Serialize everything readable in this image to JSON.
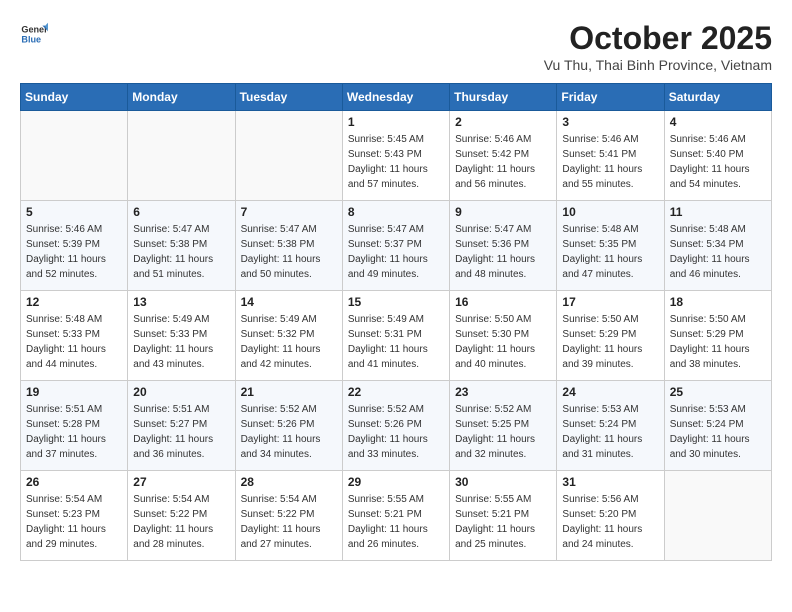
{
  "logo": {
    "line1": "General",
    "line2": "Blue"
  },
  "title": "October 2025",
  "subtitle": "Vu Thu, Thai Binh Province, Vietnam",
  "weekdays": [
    "Sunday",
    "Monday",
    "Tuesday",
    "Wednesday",
    "Thursday",
    "Friday",
    "Saturday"
  ],
  "weeks": [
    [
      {
        "day": "",
        "info": ""
      },
      {
        "day": "",
        "info": ""
      },
      {
        "day": "",
        "info": ""
      },
      {
        "day": "1",
        "info": "Sunrise: 5:45 AM\nSunset: 5:43 PM\nDaylight: 11 hours\nand 57 minutes."
      },
      {
        "day": "2",
        "info": "Sunrise: 5:46 AM\nSunset: 5:42 PM\nDaylight: 11 hours\nand 56 minutes."
      },
      {
        "day": "3",
        "info": "Sunrise: 5:46 AM\nSunset: 5:41 PM\nDaylight: 11 hours\nand 55 minutes."
      },
      {
        "day": "4",
        "info": "Sunrise: 5:46 AM\nSunset: 5:40 PM\nDaylight: 11 hours\nand 54 minutes."
      }
    ],
    [
      {
        "day": "5",
        "info": "Sunrise: 5:46 AM\nSunset: 5:39 PM\nDaylight: 11 hours\nand 52 minutes."
      },
      {
        "day": "6",
        "info": "Sunrise: 5:47 AM\nSunset: 5:38 PM\nDaylight: 11 hours\nand 51 minutes."
      },
      {
        "day": "7",
        "info": "Sunrise: 5:47 AM\nSunset: 5:38 PM\nDaylight: 11 hours\nand 50 minutes."
      },
      {
        "day": "8",
        "info": "Sunrise: 5:47 AM\nSunset: 5:37 PM\nDaylight: 11 hours\nand 49 minutes."
      },
      {
        "day": "9",
        "info": "Sunrise: 5:47 AM\nSunset: 5:36 PM\nDaylight: 11 hours\nand 48 minutes."
      },
      {
        "day": "10",
        "info": "Sunrise: 5:48 AM\nSunset: 5:35 PM\nDaylight: 11 hours\nand 47 minutes."
      },
      {
        "day": "11",
        "info": "Sunrise: 5:48 AM\nSunset: 5:34 PM\nDaylight: 11 hours\nand 46 minutes."
      }
    ],
    [
      {
        "day": "12",
        "info": "Sunrise: 5:48 AM\nSunset: 5:33 PM\nDaylight: 11 hours\nand 44 minutes."
      },
      {
        "day": "13",
        "info": "Sunrise: 5:49 AM\nSunset: 5:33 PM\nDaylight: 11 hours\nand 43 minutes."
      },
      {
        "day": "14",
        "info": "Sunrise: 5:49 AM\nSunset: 5:32 PM\nDaylight: 11 hours\nand 42 minutes."
      },
      {
        "day": "15",
        "info": "Sunrise: 5:49 AM\nSunset: 5:31 PM\nDaylight: 11 hours\nand 41 minutes."
      },
      {
        "day": "16",
        "info": "Sunrise: 5:50 AM\nSunset: 5:30 PM\nDaylight: 11 hours\nand 40 minutes."
      },
      {
        "day": "17",
        "info": "Sunrise: 5:50 AM\nSunset: 5:29 PM\nDaylight: 11 hours\nand 39 minutes."
      },
      {
        "day": "18",
        "info": "Sunrise: 5:50 AM\nSunset: 5:29 PM\nDaylight: 11 hours\nand 38 minutes."
      }
    ],
    [
      {
        "day": "19",
        "info": "Sunrise: 5:51 AM\nSunset: 5:28 PM\nDaylight: 11 hours\nand 37 minutes."
      },
      {
        "day": "20",
        "info": "Sunrise: 5:51 AM\nSunset: 5:27 PM\nDaylight: 11 hours\nand 36 minutes."
      },
      {
        "day": "21",
        "info": "Sunrise: 5:52 AM\nSunset: 5:26 PM\nDaylight: 11 hours\nand 34 minutes."
      },
      {
        "day": "22",
        "info": "Sunrise: 5:52 AM\nSunset: 5:26 PM\nDaylight: 11 hours\nand 33 minutes."
      },
      {
        "day": "23",
        "info": "Sunrise: 5:52 AM\nSunset: 5:25 PM\nDaylight: 11 hours\nand 32 minutes."
      },
      {
        "day": "24",
        "info": "Sunrise: 5:53 AM\nSunset: 5:24 PM\nDaylight: 11 hours\nand 31 minutes."
      },
      {
        "day": "25",
        "info": "Sunrise: 5:53 AM\nSunset: 5:24 PM\nDaylight: 11 hours\nand 30 minutes."
      }
    ],
    [
      {
        "day": "26",
        "info": "Sunrise: 5:54 AM\nSunset: 5:23 PM\nDaylight: 11 hours\nand 29 minutes."
      },
      {
        "day": "27",
        "info": "Sunrise: 5:54 AM\nSunset: 5:22 PM\nDaylight: 11 hours\nand 28 minutes."
      },
      {
        "day": "28",
        "info": "Sunrise: 5:54 AM\nSunset: 5:22 PM\nDaylight: 11 hours\nand 27 minutes."
      },
      {
        "day": "29",
        "info": "Sunrise: 5:55 AM\nSunset: 5:21 PM\nDaylight: 11 hours\nand 26 minutes."
      },
      {
        "day": "30",
        "info": "Sunrise: 5:55 AM\nSunset: 5:21 PM\nDaylight: 11 hours\nand 25 minutes."
      },
      {
        "day": "31",
        "info": "Sunrise: 5:56 AM\nSunset: 5:20 PM\nDaylight: 11 hours\nand 24 minutes."
      },
      {
        "day": "",
        "info": ""
      }
    ]
  ]
}
